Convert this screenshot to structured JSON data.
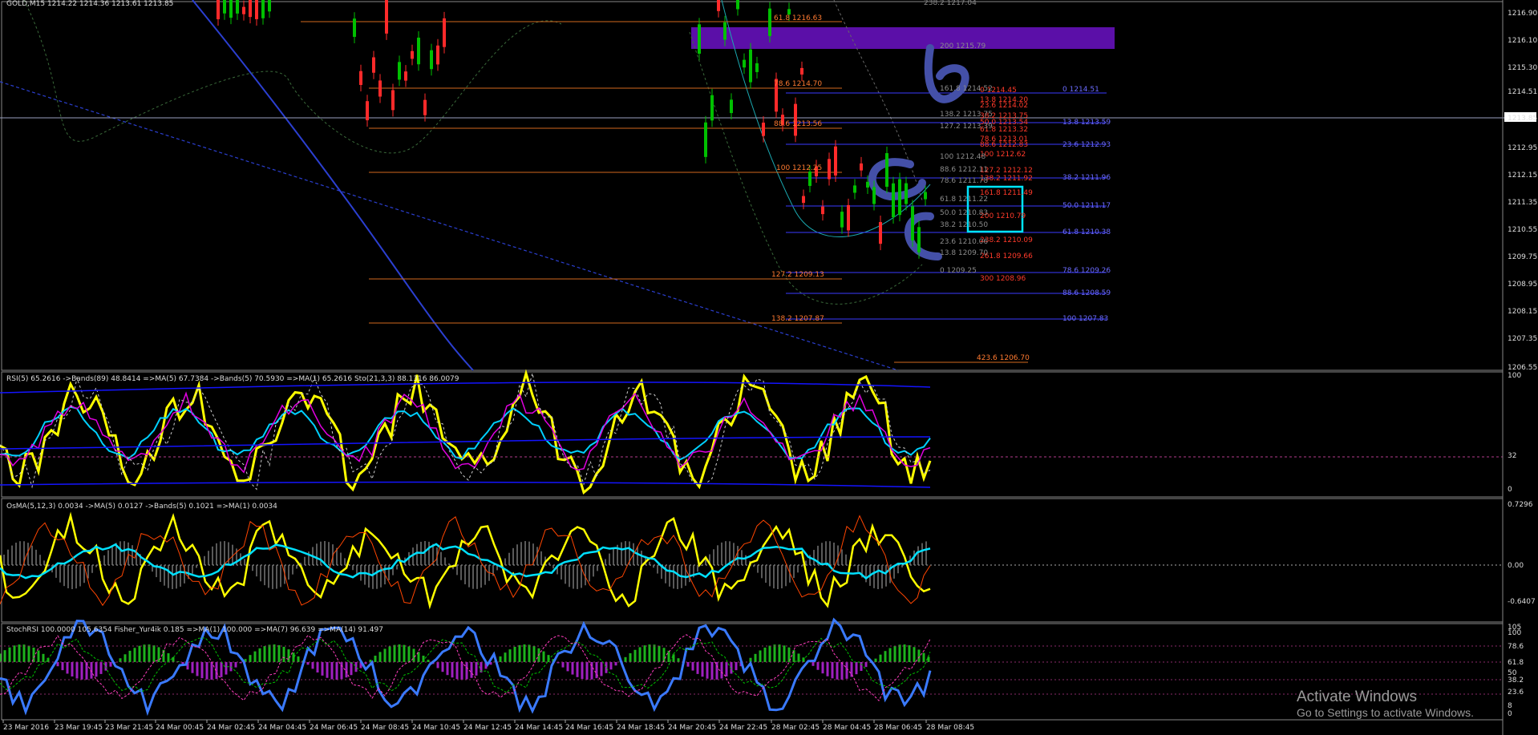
{
  "header": {
    "symbol": "GOLD,M15",
    "ohlc": "1214.22 1214.36 1213.61 1213.85",
    "symbol_line": "GOLD,M15  1214.22 1214.36 1213.61 1213.85"
  },
  "price_axis": {
    "labels": [
      "1216.90",
      "1216.10",
      "1215.30",
      "1214.51",
      "1213.85",
      "1212.95",
      "1212.15",
      "1211.35",
      "1210.55",
      "1209.75",
      "1208.95",
      "1208.15",
      "1207.35",
      "1206.55"
    ],
    "current": "1213.85"
  },
  "fib_labels": {
    "orange": [
      "61.8 1216.63",
      "78.6 1214.70",
      "88.6 1213.56",
      "100 1212.25",
      "127.2 1209.13",
      "138.2 1207.87",
      "423.6 1206.70"
    ],
    "red": [
      "0 1214.45",
      "13.8 1214.20",
      "23.6 1214.02",
      "38.2 1213.75",
      "50.0 1213.54",
      "61.8 1213.32",
      "78.6 1213.01",
      "88.6 1212.83",
      "100 1212.62",
      "127.2 1212.12",
      "138.2 1211.92",
      "161.8 1211.49",
      "200 1210.79",
      "238.2 1210.09",
      "261.8 1209.66",
      "300 1208.96"
    ],
    "blue": [
      "0 1214.51",
      "13.8 1213.59",
      "23.6 1212.93",
      "38.2 1211.96",
      "50.0 1211.17",
      "61.8 1210.38",
      "78.6 1209.26",
      "88.6 1208.59",
      "100 1207.83"
    ],
    "gray": [
      "238.2 1217.04",
      "200 1215.79",
      "161.8 1214.52",
      "138.2 1213.75",
      "127.2 1213.39",
      "100 1212.48",
      "88.6 1212.11",
      "78.6 1211.78",
      "61.8 1211.22",
      "50.0 1210.83",
      "38.2 1210.50",
      "23.6 1210.06",
      "13.8 1209.70",
      "0 1209.25"
    ]
  },
  "rsi_panel": {
    "title": "RSI(5) 65.2616  ->Bands(89) 48.8414  =>MA(5) 67.7384  ->Bands(5) 70.5930  =>MA(1) 65.2616  Sto(21,3,3) 88.1316 86.0079",
    "axis": [
      "100",
      "32",
      "0"
    ]
  },
  "osma_panel": {
    "title": "OsMA(5,12,3) 0.0034  ->MA(5) 0.0127  ->Bands(5) 0.1021  =>MA(1) 0.0034",
    "axis": [
      "0.7296",
      "0.00",
      "-0.6407"
    ]
  },
  "fisher_panel": {
    "title": "StochRSI 100.0000 105.6354  Fisher_Yur4ik 0.185  =>MA(1) 100.000  =>MA(7) 96.639  =>MA(14) 91.497",
    "axis": [
      "105",
      "100",
      "78.6",
      "61.8",
      "50",
      "38.2",
      "23.6",
      "8",
      "0"
    ]
  },
  "time_axis": [
    "23 Mar 2016",
    "23 Mar 19:45",
    "23 Mar 21:45",
    "24 Mar 00:45",
    "24 Mar 02:45",
    "24 Mar 04:45",
    "24 Mar 06:45",
    "24 Mar 08:45",
    "24 Mar 10:45",
    "24 Mar 12:45",
    "24 Mar 14:45",
    "24 Mar 16:45",
    "24 Mar 18:45",
    "24 Mar 20:45",
    "24 Mar 22:45",
    "28 Mar 02:45",
    "28 Mar 04:45",
    "28 Mar 06:45",
    "28 Mar 08:45"
  ],
  "watermark": {
    "line1": "Activate Windows",
    "line2": "Go to Settings to activate Windows."
  },
  "colors": {
    "bull": "#00c000",
    "bear": "#ff2a2a",
    "orange_fib": "#d2691e",
    "blue_fib": "#3a3aff",
    "purple_zone": "#5b0fa8",
    "cyan_box": "#00e5ff"
  }
}
